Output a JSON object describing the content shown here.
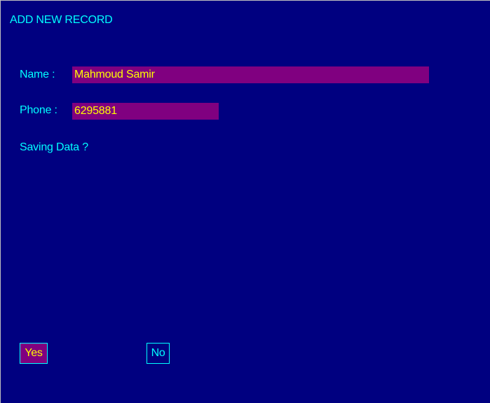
{
  "window": {
    "title": "ADD NEW RECORD"
  },
  "form": {
    "name_label": "Name :",
    "name_value": "Mahmoud Samir",
    "phone_label": "Phone :",
    "phone_value": "6295881",
    "prompt": "Saving Data ?"
  },
  "actions": {
    "yes_label": "Yes",
    "no_label": "No"
  },
  "colors": {
    "background": "#000080",
    "text": "#00ffff",
    "field_bg": "#800080",
    "field_text": "#ffff00"
  }
}
